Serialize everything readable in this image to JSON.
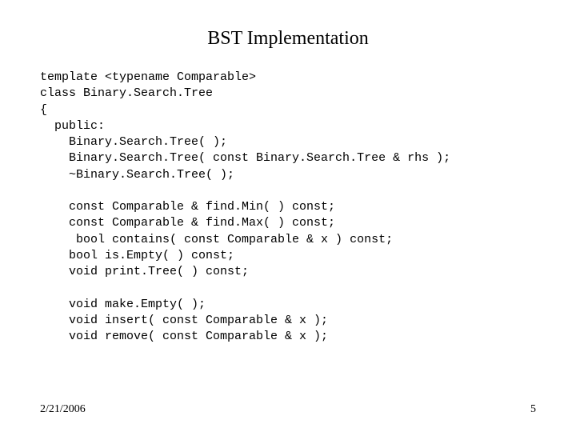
{
  "title": "BST Implementation",
  "code": "template <typename Comparable>\nclass Binary.Search.Tree\n{\n  public:\n    Binary.Search.Tree( );\n    Binary.Search.Tree( const Binary.Search.Tree & rhs );\n    ~Binary.Search.Tree( );\n\n    const Comparable & find.Min( ) const;\n    const Comparable & find.Max( ) const;\n     bool contains( const Comparable & x ) const;\n    bool is.Empty( ) const;\n    void print.Tree( ) const;\n\n    void make.Empty( );\n    void insert( const Comparable & x );\n    void remove( const Comparable & x );",
  "footer": {
    "date": "2/21/2006",
    "page": "5"
  }
}
